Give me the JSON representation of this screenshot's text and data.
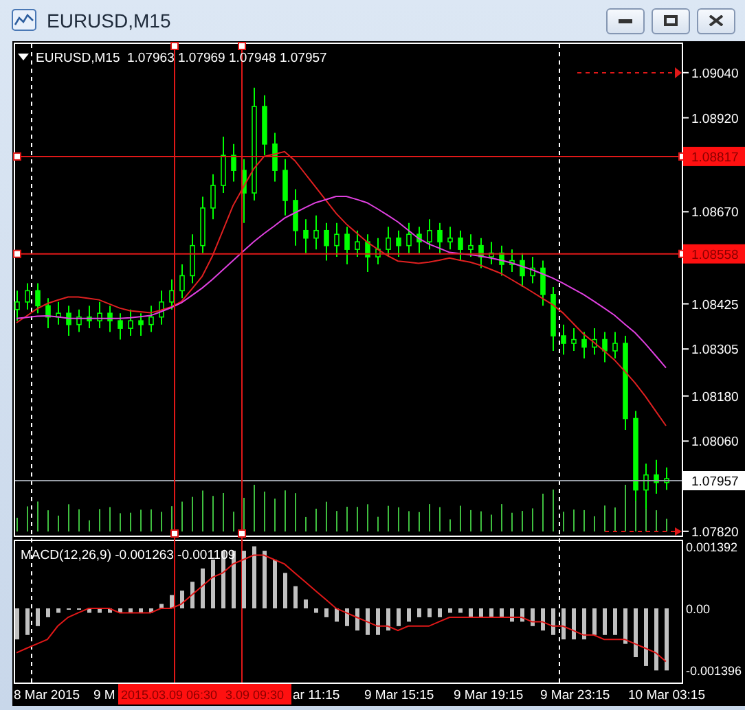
{
  "window": {
    "title": "EURUSD,M15"
  },
  "chart": {
    "header": "EURUSD,M15  1.07963 1.07969 1.07948 1.07957",
    "chart_data": {
      "type": "candlestick",
      "ylim": [
        1.07805,
        1.0912
      ],
      "yticks": [
        {
          "value": 1.0904,
          "label": "1.09040"
        },
        {
          "value": 1.0892,
          "label": "1.08920"
        },
        {
          "value": 1.0867,
          "label": "1.08670"
        },
        {
          "value": 1.08425,
          "label": "1.08425"
        },
        {
          "value": 1.08305,
          "label": "1.08305"
        },
        {
          "value": 1.0818,
          "label": "1.08180"
        },
        {
          "value": 1.0806,
          "label": "1.08060"
        },
        {
          "value": 1.0782,
          "label": "1.07820"
        }
      ],
      "ohlc": [
        [
          1.0841,
          1.0846,
          1.0838,
          1.0843
        ],
        [
          1.0843,
          1.0848,
          1.0841,
          1.0846
        ],
        [
          1.0846,
          1.0848,
          1.084,
          1.0842
        ],
        [
          1.0842,
          1.0844,
          1.0836,
          1.0839
        ],
        [
          1.0839,
          1.0843,
          1.0837,
          1.084
        ],
        [
          1.084,
          1.0842,
          1.0834,
          1.0837
        ],
        [
          1.0837,
          1.0841,
          1.0835,
          1.0839
        ],
        [
          1.0839,
          1.0842,
          1.0836,
          1.0838
        ],
        [
          1.0838,
          1.0843,
          1.0836,
          1.084
        ],
        [
          1.084,
          1.0842,
          1.0835,
          1.0838
        ],
        [
          1.0838,
          1.084,
          1.0833,
          1.0836
        ],
        [
          1.0836,
          1.0841,
          1.0834,
          1.0838
        ],
        [
          1.0838,
          1.084,
          1.0834,
          1.0837
        ],
        [
          1.0837,
          1.0842,
          1.0835,
          1.0839
        ],
        [
          1.0839,
          1.0846,
          1.0837,
          1.0843
        ],
        [
          1.0843,
          1.0849,
          1.0841,
          1.0846
        ],
        [
          1.0846,
          1.0853,
          1.0844,
          1.085
        ],
        [
          1.085,
          1.0861,
          1.0848,
          1.0858
        ],
        [
          1.0858,
          1.0871,
          1.0856,
          1.0868
        ],
        [
          1.0868,
          1.0877,
          1.0865,
          1.0874
        ],
        [
          1.0874,
          1.0887,
          1.0872,
          1.0882
        ],
        [
          1.0882,
          1.0885,
          1.0875,
          1.0878
        ],
        [
          1.0878,
          1.0881,
          1.0864,
          1.0872
        ],
        [
          1.0872,
          1.09,
          1.087,
          1.0895
        ],
        [
          1.0895,
          1.0898,
          1.0882,
          1.0885
        ],
        [
          1.0885,
          1.0888,
          1.0875,
          1.0878
        ],
        [
          1.0878,
          1.0881,
          1.0866,
          1.087
        ],
        [
          1.087,
          1.0873,
          1.0858,
          1.0862
        ],
        [
          1.0862,
          1.0865,
          1.0856,
          1.086
        ],
        [
          1.086,
          1.0866,
          1.0857,
          1.0862
        ],
        [
          1.0862,
          1.0864,
          1.0854,
          1.0858
        ],
        [
          1.0858,
          1.0864,
          1.0855,
          1.0861
        ],
        [
          1.0861,
          1.0863,
          1.0853,
          1.0857
        ],
        [
          1.0857,
          1.0862,
          1.0855,
          1.0859
        ],
        [
          1.0859,
          1.0861,
          1.0851,
          1.0855
        ],
        [
          1.0855,
          1.086,
          1.0853,
          1.0857
        ],
        [
          1.0857,
          1.0863,
          1.0855,
          1.086
        ],
        [
          1.086,
          1.0862,
          1.0855,
          1.0858
        ],
        [
          1.0858,
          1.0864,
          1.0856,
          1.0861
        ],
        [
          1.0861,
          1.0863,
          1.0856,
          1.0859
        ],
        [
          1.0859,
          1.0865,
          1.0857,
          1.0862
        ],
        [
          1.0862,
          1.0864,
          1.0856,
          1.0859
        ],
        [
          1.0859,
          1.0863,
          1.0857,
          1.086
        ],
        [
          1.086,
          1.0862,
          1.0854,
          1.0857
        ],
        [
          1.0857,
          1.0861,
          1.0855,
          1.0858
        ],
        [
          1.0858,
          1.086,
          1.0852,
          1.0855
        ],
        [
          1.0855,
          1.0859,
          1.0853,
          1.0856
        ],
        [
          1.0856,
          1.0858,
          1.085,
          1.0853
        ],
        [
          1.0853,
          1.0857,
          1.0851,
          1.0854
        ],
        [
          1.0854,
          1.0856,
          1.0847,
          1.085
        ],
        [
          1.085,
          1.0855,
          1.0848,
          1.0852
        ],
        [
          1.0852,
          1.0854,
          1.0842,
          1.0845
        ],
        [
          1.0845,
          1.0847,
          1.083,
          1.0834
        ],
        [
          1.0834,
          1.0837,
          1.0829,
          1.0832
        ],
        [
          1.0832,
          1.0836,
          1.083,
          1.0833
        ],
        [
          1.0833,
          1.0835,
          1.0828,
          1.0831
        ],
        [
          1.0831,
          1.0836,
          1.0829,
          1.0833
        ],
        [
          1.0833,
          1.0835,
          1.0827,
          1.083
        ],
        [
          1.083,
          1.0835,
          1.0828,
          1.0832
        ],
        [
          1.0832,
          1.0834,
          1.0809,
          1.0812
        ],
        [
          1.0812,
          1.0814,
          1.079,
          1.0793
        ],
        [
          1.0793,
          1.08,
          1.0788,
          1.0797
        ],
        [
          1.0797,
          1.0801,
          1.0792,
          1.0795
        ],
        [
          1.0795,
          1.0799,
          1.0793,
          1.0796
        ]
      ],
      "series": [
        {
          "type": "line",
          "color": "#e02020",
          "values": [
            1.08375,
            1.08393,
            1.08412,
            1.08426,
            1.08435,
            1.08443,
            1.08443,
            1.0844,
            1.08436,
            1.08425,
            1.08414,
            1.08407,
            1.08404,
            1.08401,
            1.08408,
            1.08417,
            1.08431,
            1.08464,
            1.08498,
            1.08552,
            1.08619,
            1.08686,
            1.08735,
            1.08784,
            1.08817,
            1.08823,
            1.0883,
            1.08806,
            1.08771,
            1.08736,
            1.08701,
            1.08666,
            1.08637,
            1.08613,
            1.0859,
            1.08571,
            1.08553,
            1.08539,
            1.08536,
            1.08533,
            1.08536,
            1.08541,
            1.08547,
            1.08541,
            1.08536,
            1.08528,
            1.08517,
            1.08506,
            1.0849,
            1.08474,
            1.08457,
            1.0844,
            1.08423,
            1.08401,
            1.08373,
            1.08345,
            1.08323,
            1.083,
            1.08276,
            1.08246,
            1.08215,
            1.08179,
            1.0814,
            1.08101
          ]
        },
        {
          "type": "line",
          "color": "#e040e0",
          "values": [
            1.08386,
            1.08389,
            1.08392,
            1.08393,
            1.0839,
            1.08387,
            1.08386,
            1.08386,
            1.08386,
            1.08386,
            1.08386,
            1.08388,
            1.08391,
            1.08394,
            1.08404,
            1.08415,
            1.08428,
            1.08447,
            1.08467,
            1.0849,
            1.08515,
            1.0854,
            1.08565,
            1.0859,
            1.08612,
            1.08632,
            1.08653,
            1.08667,
            1.08681,
            1.08694,
            1.08702,
            1.08711,
            1.08711,
            1.08703,
            1.08694,
            1.08678,
            1.08661,
            1.08643,
            1.08621,
            1.08599,
            1.08584,
            1.08573,
            1.08562,
            1.08559,
            1.08556,
            1.08552,
            1.08547,
            1.08541,
            1.08534,
            1.08525,
            1.08516,
            1.08505,
            1.08494,
            1.0848,
            1.08465,
            1.0845,
            1.08432,
            1.08414,
            1.08395,
            1.08371,
            1.08348,
            1.08319,
            1.08287,
            1.08255
          ]
        }
      ]
    },
    "horizontal_lines": [
      {
        "label": "1.08817"
      },
      {
        "label": "1.08558"
      }
    ],
    "current_price": "1.07957",
    "indicator": {
      "histogram": {
        "chart_data": {
          "type": "bar",
          "title": "MACD(12,26,9) -0.001263 -0.001109",
          "ylim": [
            -0.001673,
            0.001518
          ],
          "yticks": [
            {
              "value": 0.001392,
              "label": "0.001392"
            },
            {
              "value": 0,
              "label": "0.00"
            },
            {
              "value": -0.001396,
              "label": "-0.001396"
            }
          ],
          "series": [
            {
              "type": "bar",
              "color": "#c0c0c0",
              "values": [
                -0.0007,
                -0.0006,
                -0.0004,
                -0.0002,
                -0.0001,
                0,
                0,
                -0.0001,
                -0.0001,
                -0.0001,
                -0.0001,
                -0.0001,
                -0.0001,
                -0.0001,
                0.0001,
                0.0003,
                0.0004,
                0.0006,
                0.0009,
                0.0011,
                0.0013,
                0.0013,
                0.0013,
                0.0014,
                0.0013,
                0.0011,
                0.0008,
                0.0005,
                0.0002,
                -0.0001,
                -0.0002,
                -0.0003,
                -0.0004,
                -0.0005,
                -0.0006,
                -0.0006,
                -0.0005,
                -0.0004,
                -0.0003,
                -0.0002,
                -0.0002,
                -0.0002,
                -0.0001,
                -0.0001,
                -0.0002,
                -0.0002,
                -0.0002,
                -0.0002,
                -0.0003,
                -0.0003,
                -0.0004,
                -0.0005,
                -0.0006,
                -0.0007,
                -0.0007,
                -0.0007,
                -0.0006,
                -0.0006,
                -0.0006,
                -0.0008,
                -0.0011,
                -0.0013,
                -0.0014,
                -0.0014
              ]
            },
            {
              "type": "line",
              "color": "#e01818",
              "values": [
                -0.001,
                -0.0009,
                -0.0008,
                -0.0007,
                -0.0004,
                -0.0002,
                -0.0001,
                0,
                0,
                0,
                -0.0001,
                -0.0001,
                -0.0001,
                -0.0001,
                0,
                0,
                0.0001,
                0.0003,
                0.0005,
                0.0007,
                0.0008,
                0.001,
                0.0011,
                0.0012,
                0.0012,
                0.0011,
                0.001,
                0.0008,
                0.0006,
                0.0004,
                0.0002,
                0,
                -0.0001,
                -0.0002,
                -0.0003,
                -0.0004,
                -0.0004,
                -0.0005,
                -0.0004,
                -0.0004,
                -0.0004,
                -0.0003,
                -0.0002,
                -0.0002,
                -0.0002,
                -0.0002,
                -0.0002,
                -0.0002,
                -0.0002,
                -0.0002,
                -0.0003,
                -0.0003,
                -0.0004,
                -0.0004,
                -0.0005,
                -0.0006,
                -0.0006,
                -0.0007,
                -0.0007,
                -0.0007,
                -0.0008,
                -0.0009,
                -0.001,
                -0.0012
              ]
            }
          ]
        }
      }
    },
    "time_labels": [
      "8 Mar 2015",
      "9 M",
      "ar 11:15",
      "9 Mar 15:15",
      "9 Mar 19:15",
      "9 Mar 23:15",
      "10 Mar 03:15"
    ],
    "vertical_lines": [
      {
        "label": "2015.03.09 06:30"
      },
      {
        "label": "3.09 09:30"
      }
    ]
  }
}
